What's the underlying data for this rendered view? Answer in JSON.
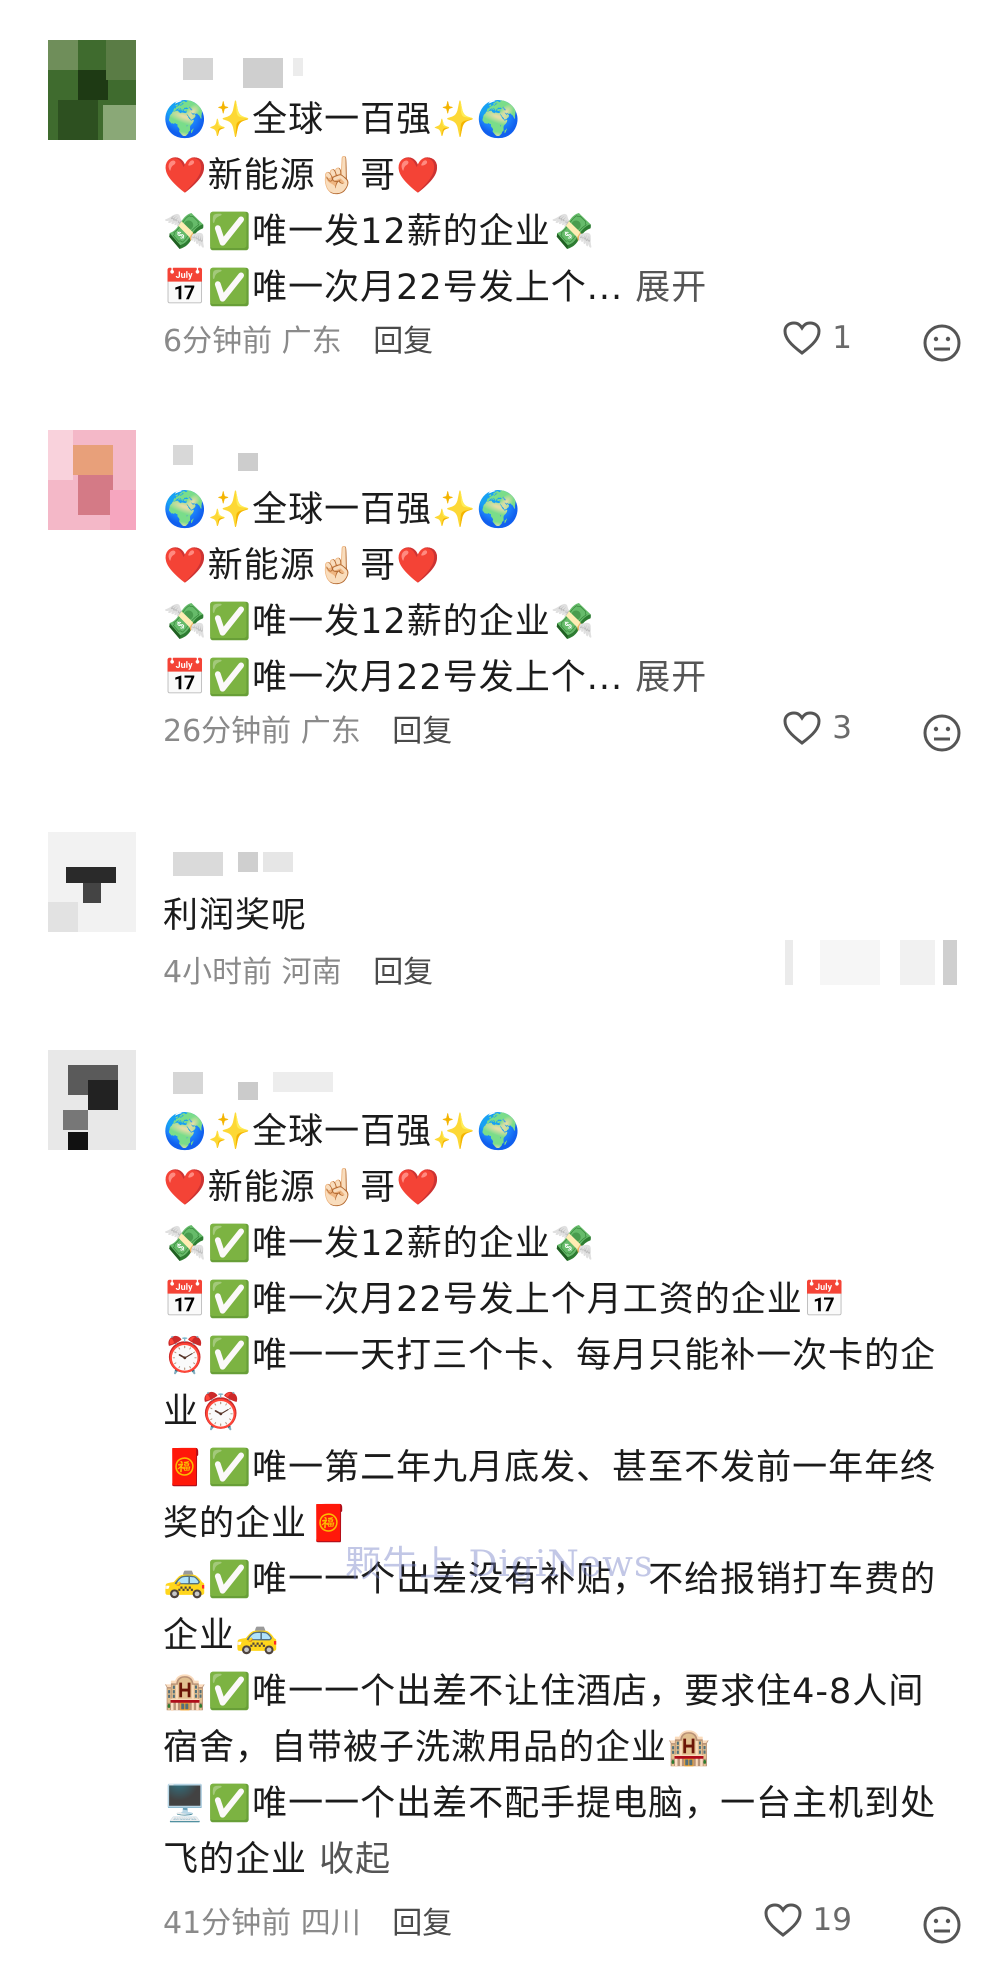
{
  "comments": [
    {
      "lines": [
        "🌍✨全球一百强✨🌍",
        "❤️新能源☝🏻哥❤️",
        "💸✅唯一发12薪的企业💸",
        "📅✅唯一次月22号发上个..."
      ],
      "expand_label": "展开",
      "time": "6分钟前",
      "location": "广东",
      "reply_label": "回复",
      "likes": "1"
    },
    {
      "lines": [
        "🌍✨全球一百强✨🌍",
        "❤️新能源☝🏻哥❤️",
        "💸✅唯一发12薪的企业💸",
        "📅✅唯一次月22号发上个..."
      ],
      "expand_label": "展开",
      "time": "26分钟前",
      "location": "广东",
      "reply_label": "回复",
      "likes": "3"
    },
    {
      "lines": [
        "利润奖呢"
      ],
      "time": "4小时前",
      "location": "河南",
      "reply_label": "回复"
    },
    {
      "lines": [
        "🌍✨全球一百强✨🌍",
        "❤️新能源☝🏻哥❤️",
        "💸✅唯一发12薪的企业💸",
        "📅✅唯一次月22号发上个月工资的企业📅",
        "⏰✅唯一一天打三个卡、每月只能补一次卡的企",
        "业⏰",
        "🧧✅唯一第二年九月底发、甚至不发前一年年终",
        "奖的企业🧧",
        "🚕✅唯一一个出差没有补贴，不给报销打车费的",
        "企业🚕",
        "🏨✅唯一一个出差不让住酒店，要求住4-8人间",
        "宿舍，自带被子洗漱用品的企业🏨",
        "🖥️✅唯一一个出差不配手提电脑，一台主机到处",
        "飞的企业"
      ],
      "collapse_label": "收起",
      "time": "41分钟前",
      "location": "四川",
      "reply_label": "回复",
      "likes": "19"
    }
  ],
  "watermark": "颗牛上 DigiNews"
}
